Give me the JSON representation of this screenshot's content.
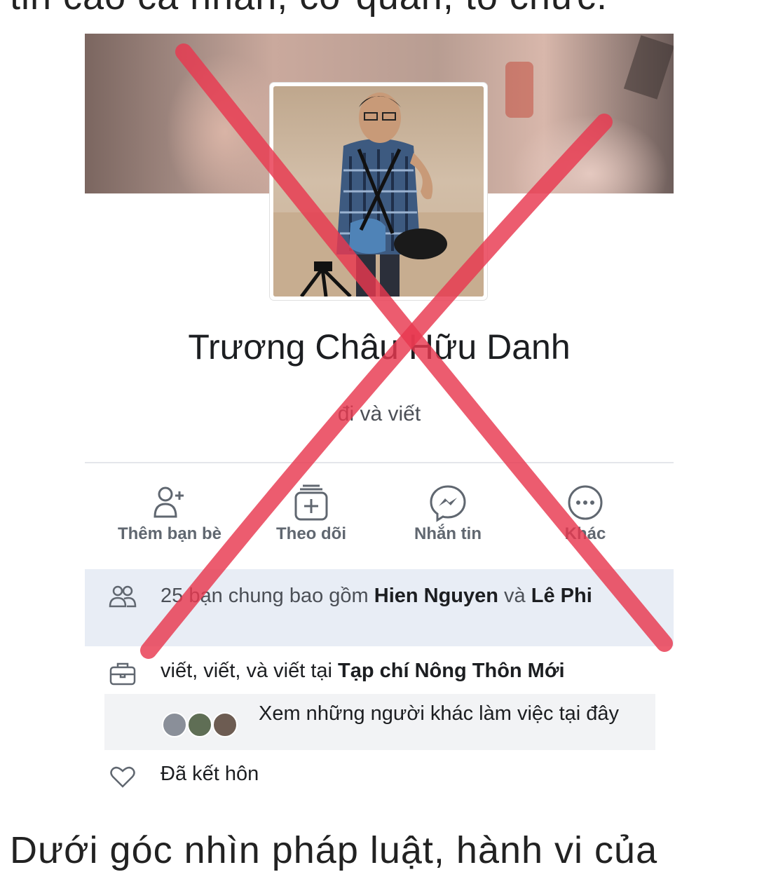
{
  "article": {
    "top_text": "tin cao cá nhân, cơ quan, tổ chức.",
    "bottom_text": "Dưới góc nhìn pháp luật, hành vi của"
  },
  "profile": {
    "name": "Trương Châu Hữu Danh",
    "bio": "đi và viết"
  },
  "actions": [
    {
      "label": "Thêm bạn bè",
      "icon": "add-friend-icon"
    },
    {
      "label": "Theo dõi",
      "icon": "follow-icon"
    },
    {
      "label": "Nhắn tin",
      "icon": "messenger-icon"
    },
    {
      "label": "Khác",
      "icon": "more-icon"
    }
  ],
  "mutual_friends": {
    "prefix": "25 bạn chung bao gồm ",
    "friend1": "Hien Nguyen",
    "joiner": " và ",
    "friend2": "Lê Phi",
    "icon": "friends-icon"
  },
  "work": {
    "prefix": "viết, viết, và viết tại ",
    "employer": "Tạp chí Nông Thôn Mới",
    "icon": "briefcase-icon"
  },
  "coworkers": {
    "text": "Xem những người khác làm việc tại đây"
  },
  "relationship": {
    "text": "Đã kết hôn",
    "icon": "heart-icon"
  },
  "colors": {
    "cross": "#e8384f",
    "mutual_bg": "#e8edf5",
    "action_text": "#606770"
  }
}
